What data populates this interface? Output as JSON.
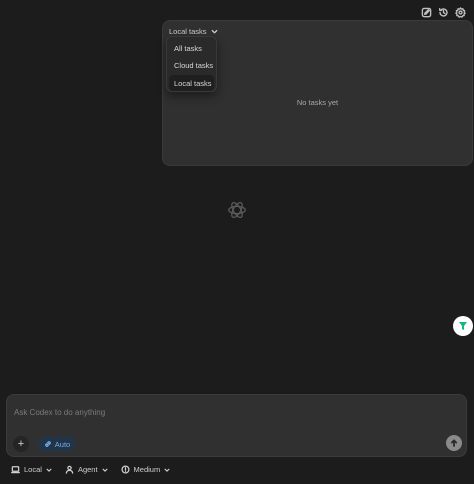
{
  "tasks_panel": {
    "filter_label": "Local tasks",
    "empty_text": "No tasks yet",
    "dropdown_options": [
      "All tasks",
      "Cloud tasks",
      "Local tasks"
    ],
    "selected_option": "Local tasks"
  },
  "composer": {
    "placeholder": "Ask Codex to do anything",
    "mode_label": "Auto"
  },
  "bottom_bar": {
    "environment_label": "Local",
    "agent_label": "Agent",
    "reasoning_label": "Medium"
  },
  "colors": {
    "background": "#1c1c1c",
    "panel": "#303030",
    "accent_blue": "#6eaef0",
    "badge_green": "#10b981"
  },
  "icons": {
    "header": [
      "new-task-icon",
      "history-icon",
      "settings-icon"
    ],
    "center": "openai-logo-icon"
  }
}
